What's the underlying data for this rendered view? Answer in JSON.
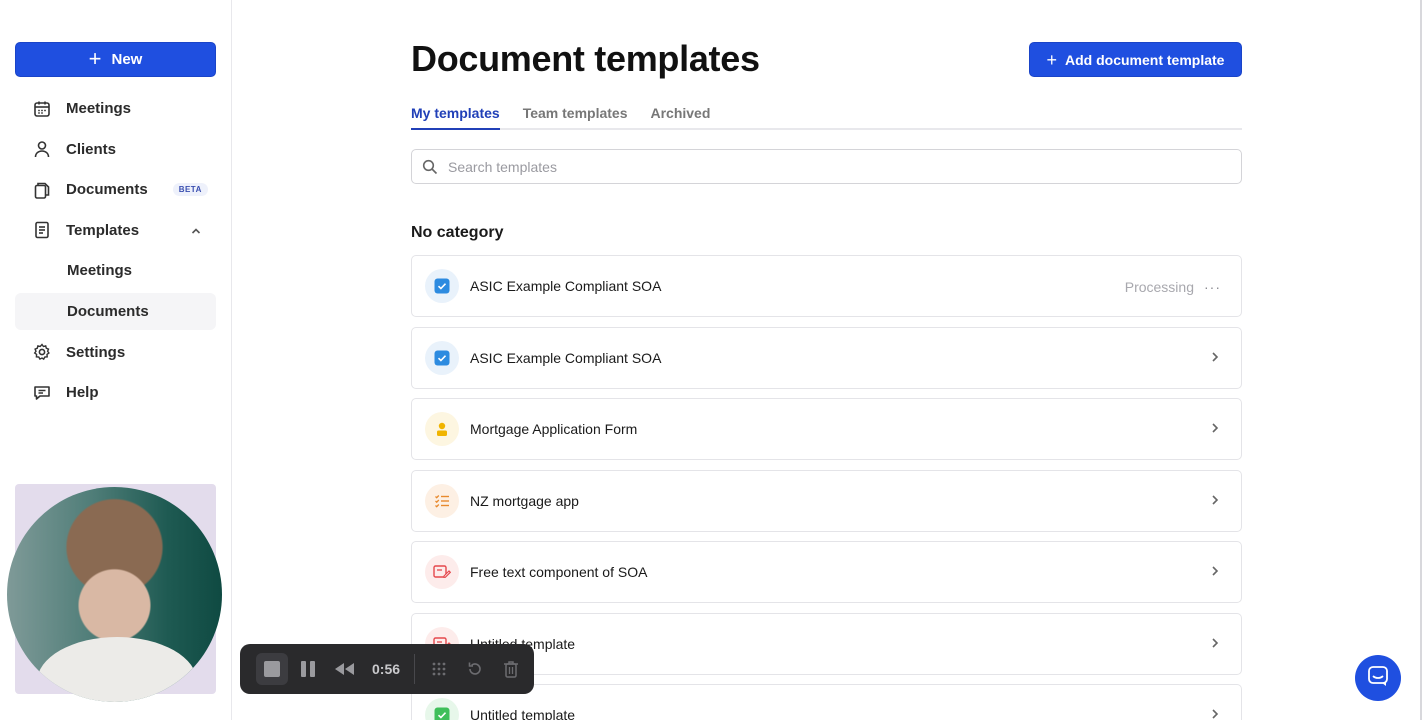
{
  "sidebar": {
    "new_label": "New",
    "items": [
      {
        "label": "Meetings",
        "icon": "calendar-icon"
      },
      {
        "label": "Clients",
        "icon": "user-icon"
      },
      {
        "label": "Documents",
        "icon": "documents-icon",
        "badge": "BETA"
      },
      {
        "label": "Templates",
        "icon": "template-icon",
        "expanded": true
      },
      {
        "label": "Meetings",
        "sub": true
      },
      {
        "label": "Documents",
        "sub": true,
        "active": true
      },
      {
        "label": "Settings",
        "icon": "gear-icon"
      },
      {
        "label": "Help",
        "icon": "chat-bubble-icon"
      }
    ]
  },
  "main": {
    "title": "Document templates",
    "add_label": "Add document template",
    "tabs": [
      {
        "label": "My templates",
        "active": true
      },
      {
        "label": "Team templates"
      },
      {
        "label": "Archived"
      }
    ],
    "search": {
      "placeholder": "Search templates",
      "value": ""
    },
    "section": "No category",
    "templates": [
      {
        "name": "ASIC Example Compliant SOA",
        "status": "Processing",
        "icon": "checkbox-icon"
      },
      {
        "name": "ASIC Example Compliant SOA",
        "icon": "checkbox-icon"
      },
      {
        "name": "Mortgage Application Form",
        "icon": "person-icon"
      },
      {
        "name": "NZ mortgage app",
        "icon": "checklist-icon"
      },
      {
        "name": "Free text component of SOA",
        "icon": "text-edit-icon"
      },
      {
        "name": "Untitled template",
        "icon": "text-edit-icon"
      },
      {
        "name": "Untitled template",
        "icon": "checkbox-icon"
      }
    ]
  },
  "recorder": {
    "time": "0:56"
  },
  "colors": {
    "accent": "#1f4fe0",
    "tab_active": "#2140b8"
  }
}
